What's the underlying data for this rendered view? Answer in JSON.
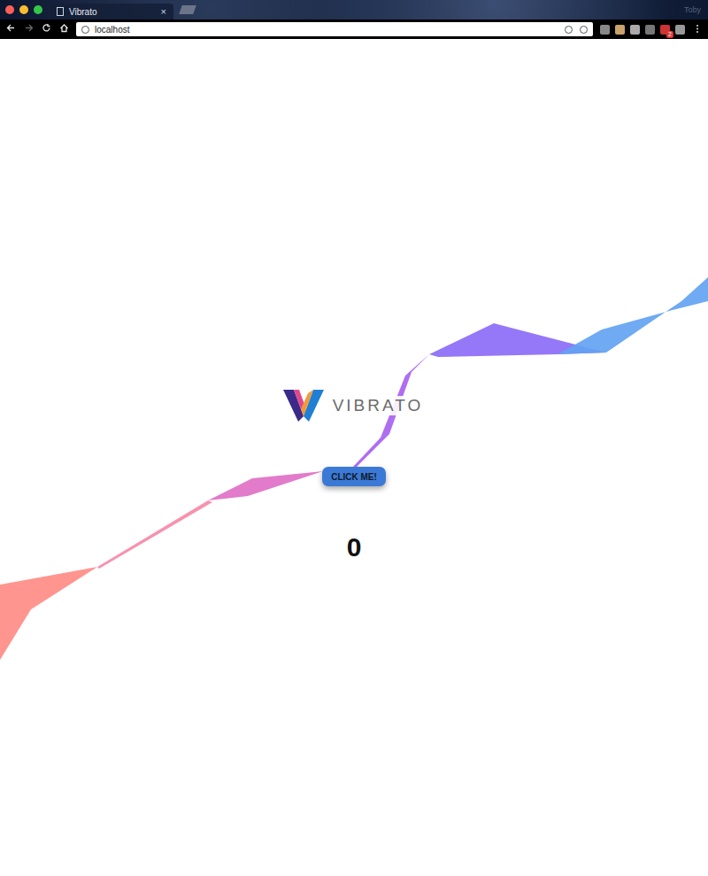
{
  "window": {
    "title": "Vibrato"
  },
  "tabs": [
    {
      "label": "Vibrato",
      "selected": true,
      "close": "×"
    }
  ],
  "profile": "Toby",
  "address_bar": {
    "url": "localhost"
  },
  "toolbar": {
    "extension_badge": "2"
  },
  "page": {
    "logo_text": "VIBRATO",
    "button": "CLICK ME!",
    "count": "0"
  }
}
